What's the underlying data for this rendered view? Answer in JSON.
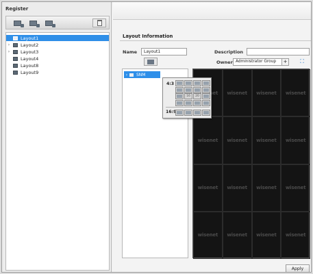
{
  "register": {
    "title": "Register",
    "toolbar": [
      "add-layout-icon",
      "copy-layout-icon",
      "export-layout-icon",
      "delete-icon"
    ]
  },
  "tree": {
    "items": [
      {
        "label": "Layout1",
        "selected": true,
        "expandable": false
      },
      {
        "label": "Layout2",
        "selected": false,
        "expandable": true
      },
      {
        "label": "Layout3",
        "selected": false,
        "expandable": true
      },
      {
        "label": "Layout4",
        "selected": false,
        "expandable": false
      },
      {
        "label": "Layout8",
        "selected": false,
        "expandable": false
      },
      {
        "label": "Layout9",
        "selected": false,
        "expandable": false
      }
    ]
  },
  "layout_info": {
    "title": "Layout Information",
    "name_label": "Name",
    "name_value": "Layout1",
    "description_label": "Description",
    "description_value": "",
    "owner_label": "Owner",
    "owner_value": "Administrator Group",
    "owner_add": "+"
  },
  "camera_list": {
    "items": [
      {
        "label": "SNM",
        "selected": true
      }
    ]
  },
  "popup": {
    "ratio_4_3": "4:3",
    "ratio_16_9": "16:9",
    "grid_4_3_labels": [
      "",
      "",
      "",
      "",
      "",
      "",
      "",
      "",
      "",
      "16",
      "20",
      "",
      "",
      "",
      "",
      ""
    ],
    "grid_16_9_labels": [
      "",
      "",
      "",
      ""
    ]
  },
  "video": {
    "watermark": "wisenet",
    "cells": 16
  },
  "footer": {
    "apply_label": "Apply"
  },
  "colors": {
    "selection": "#2f8fe8",
    "video_bg": "#141414",
    "accent": "#2d7fd0"
  }
}
